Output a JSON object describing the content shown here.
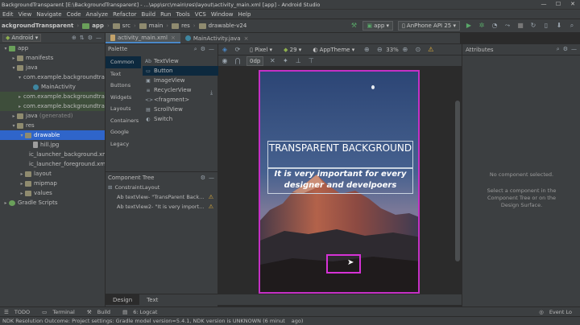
{
  "window": {
    "title": "BackgroundTransparent [E:\\BackgroundTransparent] - ...\\app\\src\\main\\res\\layout\\activity_main.xml [app] - Android Studio"
  },
  "menu": [
    "Edit",
    "View",
    "Navigate",
    "Code",
    "Analyze",
    "Refactor",
    "Build",
    "Run",
    "Tools",
    "VCS",
    "Window",
    "Help"
  ],
  "breadcrumb": {
    "project": "ackgroundTransparent",
    "items": [
      "app",
      "src",
      "main",
      "res",
      "drawable-v24"
    ]
  },
  "toolbar": {
    "run_config": "app",
    "device": "AnPhone API 25"
  },
  "project_panel": {
    "view_mode": "Android",
    "tree": [
      {
        "label": "app",
        "level": 0,
        "arrow": "▾",
        "icon": "folder-icon"
      },
      {
        "label": "manifests",
        "level": 1,
        "arrow": "▸",
        "icon": "folder-icon"
      },
      {
        "label": "java",
        "level": 1,
        "arrow": "▾",
        "icon": "folder-icon"
      },
      {
        "label": "com.example.backgroundtrans",
        "level": 2,
        "arrow": "▾",
        "icon": "package-icon"
      },
      {
        "label": "MainActivity",
        "level": 3,
        "arrow": "",
        "icon": "class-icon"
      },
      {
        "label": "com.example.backgroundtrans",
        "level": 2,
        "arrow": "▸",
        "icon": "package-icon"
      },
      {
        "label": "com.example.backgroundtrans",
        "level": 2,
        "arrow": "▸",
        "icon": "package-icon"
      },
      {
        "label": "java (generated)",
        "level": 1,
        "arrow": "▸",
        "icon": "folder-icon"
      },
      {
        "label": "res",
        "level": 1,
        "arrow": "▾",
        "icon": "folder-icon"
      },
      {
        "label": "drawable",
        "level": 2,
        "arrow": "▾",
        "icon": "folder-icon"
      },
      {
        "label": "hill.jpg",
        "level": 3,
        "arrow": "",
        "icon": "file-icon"
      },
      {
        "label": "ic_launcher_background.xml",
        "level": 3,
        "arrow": "",
        "icon": "file-icon"
      },
      {
        "label": "ic_launcher_foreground.xml",
        "level": 3,
        "arrow": "",
        "icon": "file-icon"
      },
      {
        "label": "layout",
        "level": 2,
        "arrow": "▸",
        "icon": "folder-icon"
      },
      {
        "label": "mipmap",
        "level": 2,
        "arrow": "▸",
        "icon": "folder-icon"
      },
      {
        "label": "values",
        "level": 2,
        "arrow": "▸",
        "icon": "folder-icon"
      },
      {
        "label": "Gradle Scripts",
        "level": 0,
        "arrow": "▸",
        "icon": "gradle-icon"
      }
    ]
  },
  "editor_tabs": [
    {
      "label": "activity_main.xml"
    },
    {
      "label": "MainActivity.java"
    }
  ],
  "palette": {
    "title": "Palette",
    "categories": [
      "Common",
      "Text",
      "Buttons",
      "Widgets",
      "Layouts",
      "Containers",
      "Google",
      "Legacy"
    ],
    "items": [
      {
        "icon": "Ab",
        "label": "TextView"
      },
      {
        "icon": "▭",
        "label": "Button"
      },
      {
        "icon": "▣",
        "label": "ImageView"
      },
      {
        "icon": "≡",
        "label": "RecyclerView"
      },
      {
        "icon": "<>",
        "label": "<fragment>"
      },
      {
        "icon": "▤",
        "label": "ScrollView"
      },
      {
        "icon": "◐",
        "label": "Switch"
      }
    ]
  },
  "component_tree": {
    "title": "Component Tree",
    "root": "ConstraintLayout",
    "children": [
      {
        "label": "Ab textView- \"TransParent Back...",
        "warning": "⚠"
      },
      {
        "label": "Ab textView2- \"It is very import...",
        "warning": "⚠"
      }
    ]
  },
  "design_toolbar": {
    "pixel": "Pixel",
    "api": "29",
    "theme": "AppTheme",
    "zoom": "33%",
    "margin": "0dp"
  },
  "preview": {
    "title": "TRANSPARENT BACKGROUND",
    "subtitle": "It is very important for every designer and develpoers"
  },
  "design_tabs": [
    "Design",
    "Text"
  ],
  "attributes": {
    "title": "Attributes",
    "empty": "No component selected.",
    "hint": "Select a component in the Component Tree or on the Design Surface."
  },
  "bottom_tools": [
    "TODO",
    "Terminal",
    "Build",
    "6: Logcat"
  ],
  "bottom_right": "Event Lo",
  "status": "NDK Resolution Outcome: Project settings: Gradle model version=5.4.1, NDK version is UNKNOWN (6 minut",
  "status_tail": "ago)"
}
